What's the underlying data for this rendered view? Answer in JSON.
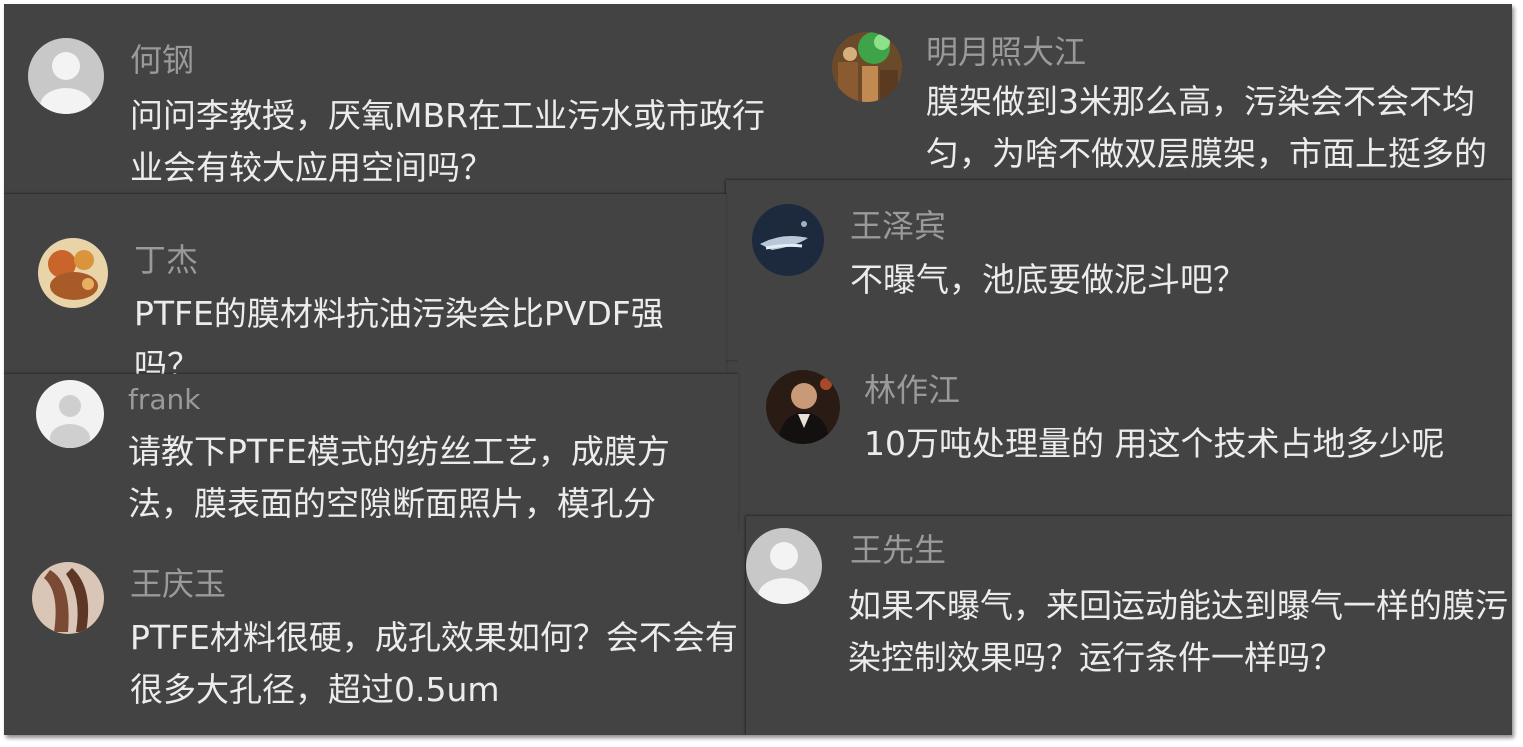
{
  "comments": [
    {
      "id": "c1",
      "name": "何钢",
      "avatar": "default-avatar-icon",
      "text": "问问李教授，厌氧MBR在工业污水或市政行业会有较大应用空间吗？"
    },
    {
      "id": "c2",
      "name": "明月照大江",
      "avatar": "photo-avatar-green",
      "text": "膜架做到3米那么高，污染会不会不均匀，为啥不做双层膜架，市面上挺多的"
    },
    {
      "id": "c3",
      "name": "丁杰",
      "avatar": "photo-avatar-food",
      "text": "PTFE的膜材料抗油污染会比PVDF强吗？"
    },
    {
      "id": "c4",
      "name": "王泽宾",
      "avatar": "photo-avatar-night",
      "text": "不曝气，池底要做泥斗吧？"
    },
    {
      "id": "c5",
      "name": "frank",
      "avatar": "default-avatar-light-icon",
      "text": "请教下PTFE模式的纺丝工艺，成膜方法，膜表面的空隙断面照片，模孔分布，如何控制孔径大小的均匀性等"
    },
    {
      "id": "c6",
      "name": "林作江",
      "avatar": "photo-avatar-portrait",
      "text": "10万吨处理量的 用这个技术占地多少呢"
    },
    {
      "id": "c7",
      "name": "王庆玉",
      "avatar": "photo-avatar-brown",
      "text": "PTFE材料很硬，成孔效果如何？会不会有很多大孔径，超过0.5um"
    },
    {
      "id": "c8",
      "name": "王先生",
      "avatar": "default-avatar-icon",
      "text": "如果不曝气，来回运动能达到曝气一样的膜污染控制效果吗？运行条件一样吗？"
    }
  ],
  "colors": {
    "background": "#434343",
    "name": "#9a9a9a",
    "text": "#ececec"
  }
}
